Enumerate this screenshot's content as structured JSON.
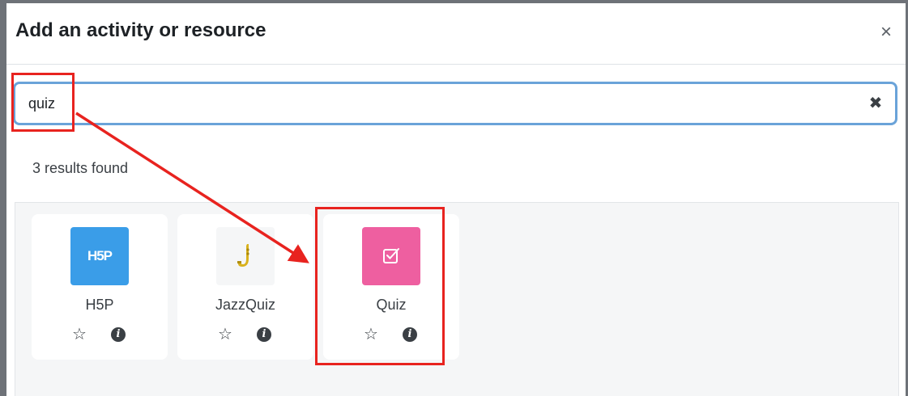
{
  "dialog": {
    "title": "Add an activity or resource",
    "close_glyph": "×"
  },
  "search": {
    "value": "quiz",
    "clear_glyph": "✖"
  },
  "results": {
    "count_text": "3 results found",
    "items": [
      {
        "label": "H5P",
        "icon": "h5p-icon",
        "icon_text": "H5P",
        "icon_color": "#3a9de8"
      },
      {
        "label": "JazzQuiz",
        "icon": "saxophone-icon",
        "icon_color": "#f5f6f7"
      },
      {
        "label": "Quiz",
        "icon": "quiz-checkbox-icon",
        "icon_color": "#ee5fa0"
      }
    ],
    "star_glyph": "☆",
    "info_glyph": "i"
  },
  "colors": {
    "search_border": "#6aa3d9",
    "annotation_red": "#e8231f"
  }
}
